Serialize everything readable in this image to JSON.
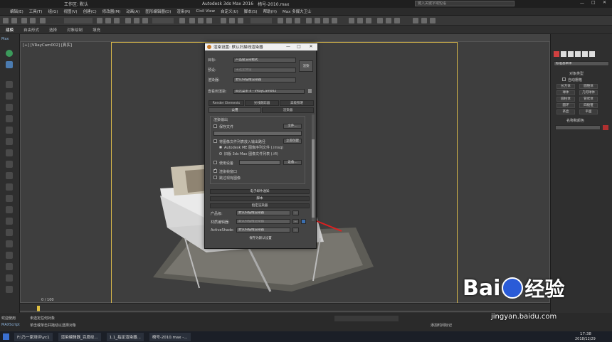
{
  "window": {
    "title": "Autodesk 3ds Max 2016",
    "file": "椅号-2010.max",
    "workspace": "工作区: 默认",
    "search_placeholder": "键入关键字或短语"
  },
  "menu": [
    "编辑(E)",
    "工具(T)",
    "组(G)",
    "视图(V)",
    "创建(C)",
    "修改器(M)",
    "动画(A)",
    "图形编辑器(D)",
    "渲染(R)",
    "Civil View",
    "自定义(U)",
    "脚本(S)",
    "帮助(H)",
    "Max 多媒大卫士"
  ],
  "ribbon": [
    "建模",
    "自由形式",
    "选择",
    "对象绘制",
    "填充"
  ],
  "leftstrip": {
    "label": "Max"
  },
  "viewport": {
    "label": "[+] [VRayCam002] [真实]"
  },
  "dialog": {
    "title": "渲染设置: 默认扫描线渲染器",
    "rows": {
      "target_label": "目标:",
      "target_value": "产品级渲染模式",
      "preset_label": "预设:",
      "preset_value": "未选定预设",
      "renderer_label": "渲染器:",
      "renderer_value": "默认扫描线渲染器",
      "render_button": "渲染",
      "view_label": "查看到渲染:",
      "view_value": "四元菜单 4 - VRayCam002"
    },
    "tabs_top": [
      "Render Elements",
      "光线跟踪器",
      "高级照明"
    ],
    "tabs_bottom": [
      "公用",
      "渲染器"
    ],
    "render_output": {
      "section": "渲染输出",
      "save_file": "保存文件",
      "files_button": "文件...",
      "put_image_label": "将图像文件列表放入输出路径",
      "create_now": "立即创建",
      "autodesk_me": "Autodesk ME 图像序列文件 (.imsq)",
      "legacy": "旧版 3ds Max 图像文件列表 (.ifl)",
      "use_device": "使用设备",
      "device_button": "设备...",
      "render_frame_window": "渲染帧窗口",
      "skip_existing": "跳过现有图像"
    },
    "rollouts": [
      "电子邮件通知",
      "脚本",
      "指定渲染器"
    ],
    "assign": {
      "production_label": "产品级:",
      "production_value": "默认扫描线渲染器",
      "material_label": "材质编辑器:",
      "material_value": "默认扫描线渲染器",
      "activeshade_label": "ActiveShade:",
      "activeshade_value": "默认扫描线渲染器",
      "save_default": "保存为默认设置",
      "dots": "..."
    }
  },
  "rightpanel": {
    "dropdown": "标准基本体",
    "section_object_type": "对象类型",
    "autogrid": "自动栅格",
    "buttons": [
      "长方体",
      "圆锥体",
      "球体",
      "几何球体",
      "圆柱体",
      "管状体",
      "圆环",
      "四棱锥",
      "茶壶",
      "平面"
    ],
    "section_name_color": "名称和颜色"
  },
  "timeline": {
    "frame": "0 / 100"
  },
  "status": {
    "line1": "未选定任何对象",
    "line2": "单击或单击并拖动以选择对象",
    "add_time_tag": "添加时间标记",
    "welcome": "欢迎使用",
    "maxscript": "MAXScript"
  },
  "taskbar": [
    "F:\\乃一家测评\\yc1",
    "渲染编辑器_百度经...",
    "1.1_指定渲染器...",
    "椅号-2010.max -..."
  ],
  "clock": {
    "time": "17:38",
    "date": "2018/12/29"
  },
  "watermark": {
    "brand": "Bai",
    "brand2": "经验",
    "url": "jingyan.baidu.com"
  }
}
